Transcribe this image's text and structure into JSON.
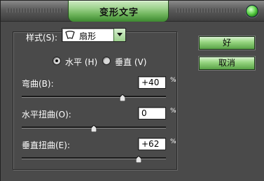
{
  "window": {
    "title": "变形文字"
  },
  "style": {
    "label": "样式(S):",
    "selected": "扇形",
    "icon": "arc-shape-icon"
  },
  "orientation": {
    "horizontal_label": "水平 (H)",
    "vertical_label": "垂直 (V)",
    "selected": "horizontal"
  },
  "bend": {
    "label": "弯曲(B):",
    "value": "+40",
    "unit": "%",
    "level_percent": 40
  },
  "horizontal_distortion": {
    "label": "水平扭曲(O):",
    "value": "0",
    "unit": "%",
    "level_percent": 0
  },
  "vertical_distortion": {
    "label": "垂直扭曲(E):",
    "value": "+62",
    "unit": "%",
    "level_percent": 62
  },
  "buttons": {
    "ok": "好",
    "cancel": "取消"
  },
  "colors": {
    "accent": "#6fb55c",
    "background": "#4a4a4a"
  }
}
